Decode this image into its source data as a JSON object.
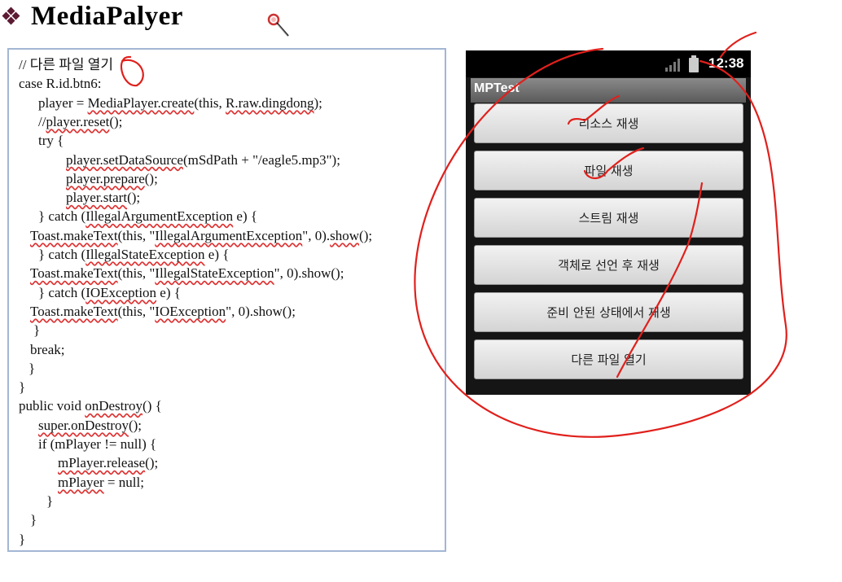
{
  "slide": {
    "title": "MediaPalyer"
  },
  "code": {
    "lines": [
      {
        "indent": 12,
        "parts": [
          {
            "t": "// 다른 파일 열기"
          }
        ]
      },
      {
        "indent": 12,
        "parts": [
          {
            "t": "case R.id.btn6:"
          }
        ]
      },
      {
        "indent": 36,
        "parts": [
          {
            "t": "player = "
          },
          {
            "t": "MediaPlayer.create",
            "sq": true
          },
          {
            "t": "(this, "
          },
          {
            "t": "R.raw.dingdong",
            "sq": true
          },
          {
            "t": ");"
          }
        ]
      },
      {
        "indent": 36,
        "parts": [
          {
            "t": "//"
          },
          {
            "t": "player.reset",
            "sq": true
          },
          {
            "t": "();"
          }
        ]
      },
      {
        "indent": 36,
        "parts": [
          {
            "t": "try {"
          }
        ]
      },
      {
        "indent": 70,
        "parts": [
          {
            "t": "player.setDataSource",
            "sq": true
          },
          {
            "t": "(mSdPath + \"/eagle5.mp3\");"
          }
        ]
      },
      {
        "indent": 70,
        "parts": [
          {
            "t": "player.prepare",
            "sq": true
          },
          {
            "t": "();"
          }
        ]
      },
      {
        "indent": 70,
        "parts": [
          {
            "t": "player.start",
            "sq": true
          },
          {
            "t": "();"
          }
        ]
      },
      {
        "indent": 36,
        "parts": [
          {
            "t": "} catch ("
          },
          {
            "t": "IllegalArgumentException",
            "sq": true
          },
          {
            "t": " e) {"
          }
        ]
      },
      {
        "indent": 26,
        "parts": [
          {
            "t": "Toast.makeText",
            "sq": true
          },
          {
            "t": "(this, \""
          },
          {
            "t": "IllegalArgumentException",
            "sq": true
          },
          {
            "t": "\", 0)."
          },
          {
            "t": "show",
            "sq": true
          },
          {
            "t": "();"
          }
        ]
      },
      {
        "indent": 36,
        "parts": [
          {
            "t": "} catch ("
          },
          {
            "t": "IllegalStateException",
            "sq": true
          },
          {
            "t": " e) {"
          }
        ]
      },
      {
        "indent": 26,
        "parts": [
          {
            "t": "Toast.makeText",
            "sq": true
          },
          {
            "t": "(this, \""
          },
          {
            "t": "IllegalStateException",
            "sq": true
          },
          {
            "t": "\", 0).show();"
          }
        ]
      },
      {
        "indent": 36,
        "parts": [
          {
            "t": "} catch ("
          },
          {
            "t": "IOException",
            "sq": true
          },
          {
            "t": " e) {"
          }
        ]
      },
      {
        "indent": 26,
        "parts": [
          {
            "t": "Toast.makeText",
            "sq": true
          },
          {
            "t": "(this, \""
          },
          {
            "t": "IOException",
            "sq": true
          },
          {
            "t": "\", 0).show();"
          }
        ]
      },
      {
        "indent": 30,
        "parts": [
          {
            "t": "}"
          }
        ]
      },
      {
        "indent": 26,
        "parts": [
          {
            "t": "break;"
          }
        ]
      },
      {
        "indent": 24,
        "parts": [
          {
            "t": "}"
          }
        ]
      },
      {
        "indent": 12,
        "parts": [
          {
            "t": "}"
          }
        ]
      },
      {
        "indent": 12,
        "parts": [
          {
            "t": "public void "
          },
          {
            "t": "onDestroy",
            "sq": true
          },
          {
            "t": "() {"
          }
        ]
      },
      {
        "indent": 36,
        "parts": [
          {
            "t": "super.onDestroy",
            "sq": true
          },
          {
            "t": "();"
          }
        ]
      },
      {
        "indent": 36,
        "parts": [
          {
            "t": "if (mPlayer != null) {"
          }
        ]
      },
      {
        "indent": 60,
        "parts": [
          {
            "t": "mPlayer.release",
            "sq": true
          },
          {
            "t": "();"
          }
        ]
      },
      {
        "indent": 60,
        "parts": [
          {
            "t": "mPlayer",
            "sq": true
          },
          {
            "t": " = null;"
          }
        ]
      },
      {
        "indent": 46,
        "parts": [
          {
            "t": "}"
          }
        ]
      },
      {
        "indent": 26,
        "parts": [
          {
            "t": "}"
          }
        ]
      },
      {
        "indent": 12,
        "parts": [
          {
            "t": "}"
          }
        ]
      }
    ]
  },
  "phone": {
    "clock": "12:38",
    "app_title": "MPTest",
    "buttons": [
      {
        "label": "리소스 재생"
      },
      {
        "label": "파일 재생"
      },
      {
        "label": "스트림 재생"
      },
      {
        "label": "객체로 선언 후 재생"
      },
      {
        "label": "준비 안된 상태에서 재생"
      },
      {
        "label": "다른 파일 열기"
      }
    ]
  },
  "colors": {
    "annotation": "#e0201c",
    "code_border": "#a3b6d4",
    "bullet": "#5c1a33"
  },
  "icons": [
    "diamond-bullet-icon",
    "magnifier-cursor-icon",
    "signal-icon",
    "battery-icon"
  ]
}
